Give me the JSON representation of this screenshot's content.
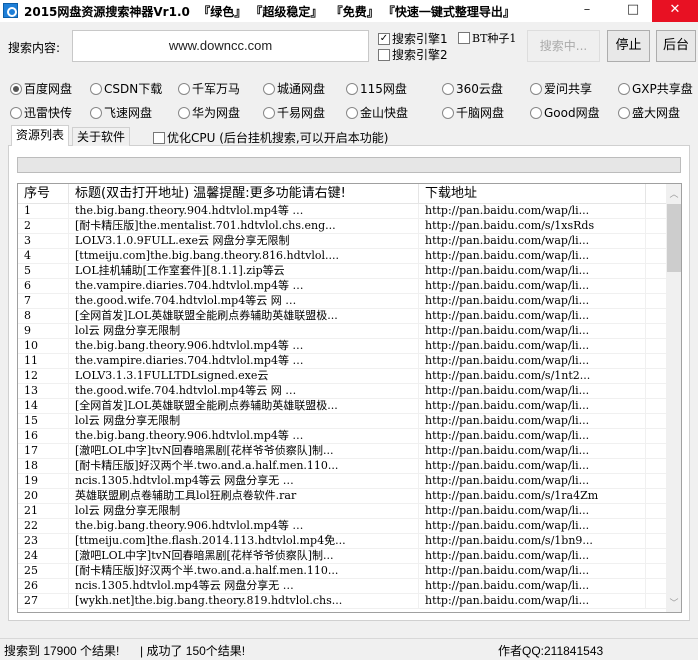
{
  "window": {
    "title": "2015网盘资源搜索神器Vr1.0  『绿色』 『超级稳定』  『免费』 『快速一键式整理导出』",
    "minimize": "–",
    "maximize": "□",
    "close": "✕"
  },
  "search": {
    "label": "搜索内容:",
    "value": "www.downcc.com",
    "engine1": "搜索引擎1",
    "engine2": "搜索引擎2",
    "bt": "BT种子1",
    "searching": "搜索中...",
    "stop": "停止",
    "background": "后台"
  },
  "sources": [
    {
      "label": "百度网盘",
      "selected": true
    },
    {
      "label": "CSDN下载"
    },
    {
      "label": "千军万马"
    },
    {
      "label": "城通网盘"
    },
    {
      "label": "115网盘"
    },
    {
      "label": "360云盘"
    },
    {
      "label": "爱问共享"
    },
    {
      "label": "GXP共享盘"
    },
    {
      "label": "迅雷快传"
    },
    {
      "label": "飞速网盘"
    },
    {
      "label": "华为网盘"
    },
    {
      "label": "千易网盘"
    },
    {
      "label": "金山快盘"
    },
    {
      "label": "千脑网盘"
    },
    {
      "label": "Good网盘"
    },
    {
      "label": "盛大网盘"
    }
  ],
  "tabs": {
    "list": "资源列表",
    "about": "关于软件",
    "optimize": "优化CPU (后台挂机搜索,可以开启本功能)"
  },
  "table": {
    "headers": [
      "序号",
      "标题(双击打开地址) 温馨提醒:更多功能请右键!",
      "下载地址"
    ],
    "rows": [
      [
        "1",
        "the.big.bang.theory.904.hdtvlol.mp4等 …",
        "http://pan.baidu.com/wap/li..."
      ],
      [
        "2",
        "[耐卡精压版]the.mentalist.701.hdtvlol.chs.eng...",
        "http://pan.baidu.com/s/1xsRds"
      ],
      [
        "3",
        "LOLV3.1.0.9FULL.exe云 网盘分享无限制",
        "http://pan.baidu.com/wap/li..."
      ],
      [
        "4",
        "[ttmeiju.com]the.big.bang.theory.816.hdtvlol....",
        "http://pan.baidu.com/wap/li..."
      ],
      [
        "5",
        "LOL挂机辅助[工作室套件][8.1.1].zip等云",
        "http://pan.baidu.com/wap/li..."
      ],
      [
        "6",
        "the.vampire.diaries.704.hdtvlol.mp4等 …",
        "http://pan.baidu.com/wap/li..."
      ],
      [
        "7",
        "the.good.wife.704.hdtvlol.mp4等云 网 …",
        "http://pan.baidu.com/wap/li..."
      ],
      [
        "8",
        "[全网首发]LOL英雄联盟全能刷点券辅助英雄联盟极...",
        "http://pan.baidu.com/wap/li..."
      ],
      [
        "9",
        "lol云 网盘分享无限制",
        "http://pan.baidu.com/wap/li..."
      ],
      [
        "10",
        "the.big.bang.theory.906.hdtvlol.mp4等 …",
        "http://pan.baidu.com/wap/li..."
      ],
      [
        "11",
        "the.vampire.diaries.704.hdtvlol.mp4等 …",
        "http://pan.baidu.com/wap/li..."
      ],
      [
        "12",
        "LOLV3.1.3.1FULLTDLsigned.exe云",
        "http://pan.baidu.com/s/1nt2..."
      ],
      [
        "13",
        "the.good.wife.704.hdtvlol.mp4等云 网 …",
        "http://pan.baidu.com/wap/li..."
      ],
      [
        "14",
        "[全网首发]LOL英雄联盟全能刷点券辅助英雄联盟极...",
        "http://pan.baidu.com/wap/li..."
      ],
      [
        "15",
        "lol云 网盘分享无限制",
        "http://pan.baidu.com/wap/li..."
      ],
      [
        "16",
        "the.big.bang.theory.906.hdtvlol.mp4等 …",
        "http://pan.baidu.com/wap/li..."
      ],
      [
        "17",
        "[澈吧LOL中字]tvN回春暗黑剧[花样爷爷侦察队]制...",
        "http://pan.baidu.com/wap/li..."
      ],
      [
        "18",
        "[耐卡精压版]好汉两个半.two.and.a.half.men.110...",
        "http://pan.baidu.com/wap/li..."
      ],
      [
        "19",
        "ncis.1305.hdtvlol.mp4等云 网盘分享无 …",
        "http://pan.baidu.com/wap/li..."
      ],
      [
        "20",
        "英雄联盟刷点卷辅助工具lol狂刷点卷软件.rar",
        "http://pan.baidu.com/s/1ra4Zm"
      ],
      [
        "21",
        "lol云 网盘分享无限制",
        "http://pan.baidu.com/wap/li..."
      ],
      [
        "22",
        "the.big.bang.theory.906.hdtvlol.mp4等 …",
        "http://pan.baidu.com/wap/li..."
      ],
      [
        "23",
        "[ttmeiju.com]the.flash.2014.113.hdtvlol.mp4免...",
        "http://pan.baidu.com/s/1bn9..."
      ],
      [
        "24",
        "[澈吧LOL中字]tvN回春暗黑剧[花样爷爷侦察队]制...",
        "http://pan.baidu.com/wap/li..."
      ],
      [
        "25",
        "[耐卡精压版]好汉两个半.two.and.a.half.men.110...",
        "http://pan.baidu.com/wap/li..."
      ],
      [
        "26",
        "ncis.1305.hdtvlol.mp4等云 网盘分享无 …",
        "http://pan.baidu.com/wap/li..."
      ],
      [
        "27",
        "[wykh.net]the.big.bang.theory.819.hdtvlol.chs...",
        "http://pan.baidu.com/wap/li..."
      ]
    ]
  },
  "status": {
    "found": "搜索到 17900 个结果!",
    "success": "| 成功了 150个结果!",
    "author": "作者QQ:211841543"
  }
}
